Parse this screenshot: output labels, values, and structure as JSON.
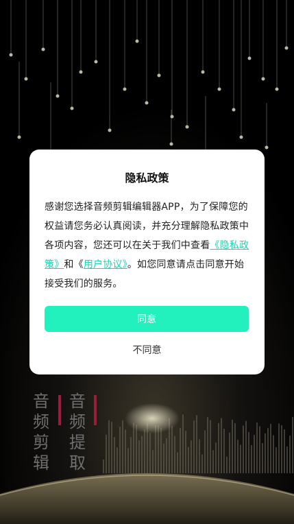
{
  "dialog": {
    "title": "隐私政策",
    "text_before": "感谢您选择音频剪辑编辑器APP，为了保障您的权益请您务必认真阅读，并充分理解隐私政策中各项内容，您还可以在关于我们中查看",
    "privacy_link": "《隐私政策》",
    "and": "和《",
    "user_agreement_link": "用户协议》",
    "text_after": "。如您同意请点击同意开始接受我们的服务。",
    "agree_label": "同意",
    "disagree_label": "不同意"
  },
  "brand": {
    "left": [
      "音",
      "频",
      "剪",
      "辑"
    ],
    "right": [
      "音",
      "频",
      "提",
      "取"
    ]
  },
  "colors": {
    "accent": "#22f0bd",
    "link": "#1ed4b0",
    "brand_bar": "#9a1d3e"
  }
}
